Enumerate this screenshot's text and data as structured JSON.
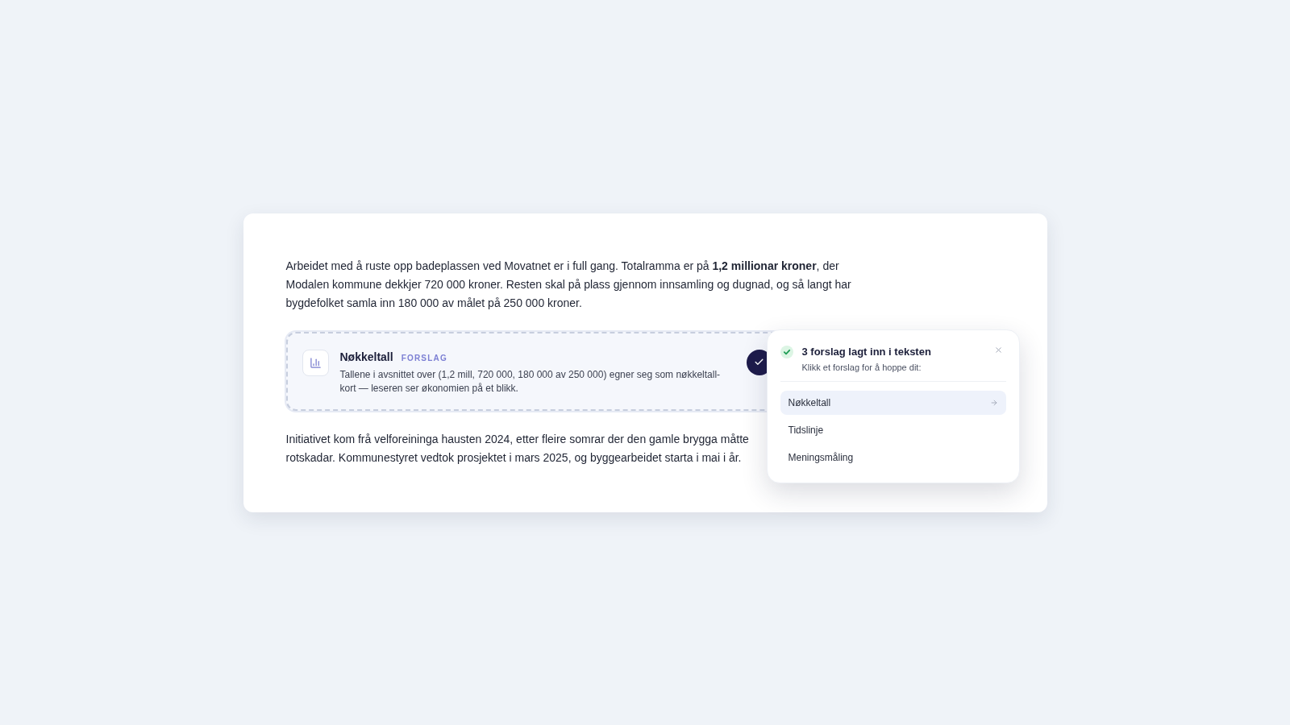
{
  "paragraph_1": "Arbeidet med å ruste opp badeplassen ved Movatnet er i full gang. Totalramma er på **1,2 millionar kroner**, der Modalen kommune dekkjer 720 000 kroner. Resten skal på plass gjennom innsamling og dugnad, og så langt har bygdefolket samla inn 180 000 av målet på 250 000 kroner.",
  "suggestion_card": {
    "title": "Nøkkeltall",
    "tag": "FORSLAG",
    "description": "Tallene i avsnittet over (1,2 mill, 720 000, 180 000 av 250 000) egner seg som nøkkeltall-kort — leseren ser økonomien på et blikk."
  },
  "paragraph_2": {
    "lines": [
      "Initiativet kom frå velforeininga hausten 2024, etter fleire somrar der den gamle brygga måtte",
      "rotskadar. Kommunestyret vedtok prosjektet i mars 2025, og byggearbeidet starta i mai i år."
    ]
  },
  "popover": {
    "title": "3 forslag lagt inn i teksten",
    "subtitle": "Klikk et forslag for å hoppe dit:",
    "items": [
      {
        "label": "Nøkkeltall",
        "selected": true
      },
      {
        "label": "Tidslinje",
        "selected": false
      },
      {
        "label": "Meningsmåling",
        "selected": false
      }
    ]
  }
}
